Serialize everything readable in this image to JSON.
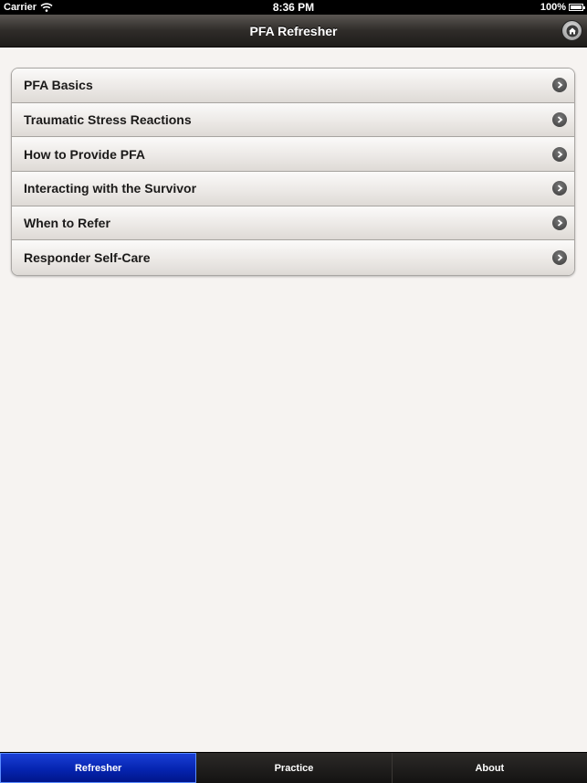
{
  "status": {
    "carrier": "Carrier",
    "time": "8:36 PM",
    "battery": "100%"
  },
  "nav": {
    "title": "PFA Refresher",
    "home_icon": "home-icon"
  },
  "menu": {
    "items": [
      {
        "label": "PFA Basics"
      },
      {
        "label": "Traumatic Stress Reactions"
      },
      {
        "label": "How to Provide PFA"
      },
      {
        "label": "Interacting with the Survivor"
      },
      {
        "label": "When to Refer"
      },
      {
        "label": "Responder Self-Care"
      }
    ]
  },
  "tabs": [
    {
      "label": "Refresher",
      "active": true
    },
    {
      "label": "Practice",
      "active": false
    },
    {
      "label": "About",
      "active": false
    }
  ],
  "colors": {
    "active_tab": "#0524b0",
    "background": "#f6f3f1"
  }
}
